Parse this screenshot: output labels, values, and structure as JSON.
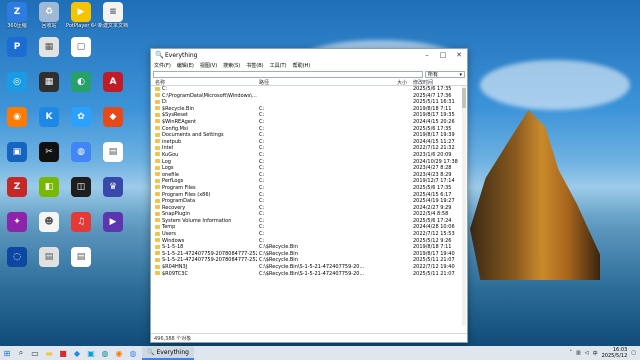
{
  "desktop": {
    "icons": [
      {
        "label": "360压缩",
        "color": "#2d7be0",
        "glyph": "Z",
        "col": 0,
        "row": 0
      },
      {
        "label": "回收站",
        "color": "#9fb8d6",
        "glyph": "♻",
        "col": 1,
        "row": 0
      },
      {
        "label": "PotPlayer 64 bit",
        "color": "#f5c400",
        "glyph": "▶",
        "col": 2,
        "row": 0
      },
      {
        "label": "新建文本文档 (2).txt",
        "color": "#f3f3f3",
        "glyph": "≡",
        "col": 3,
        "row": 0
      },
      {
        "label": "",
        "color": "#1b6dd1",
        "glyph": "P",
        "col": 0,
        "row": 1
      },
      {
        "label": "",
        "color": "#e2e2e2",
        "glyph": "▦",
        "col": 1,
        "row": 1
      },
      {
        "label": "",
        "color": "#ffffff",
        "glyph": "▢",
        "col": 2,
        "row": 1
      },
      {
        "label": "",
        "color": "#1a9be6",
        "glyph": "◎",
        "col": 0,
        "row": 2
      },
      {
        "label": "",
        "color": "#2f2f2f",
        "glyph": "▦",
        "col": 1,
        "row": 2
      },
      {
        "label": "",
        "color": "#26a269",
        "glyph": "◐",
        "col": 2,
        "row": 2
      },
      {
        "label": "",
        "color": "#c01c28",
        "glyph": "A",
        "col": 3,
        "row": 2
      },
      {
        "label": "",
        "color": "#ff7a00",
        "glyph": "◉",
        "col": 0,
        "row": 3
      },
      {
        "label": "",
        "color": "#1e88e5",
        "glyph": "K",
        "col": 1,
        "row": 3
      },
      {
        "label": "",
        "color": "#2aa0ff",
        "glyph": "✿",
        "col": 2,
        "row": 3
      },
      {
        "label": "",
        "color": "#e64a19",
        "glyph": "◆",
        "col": 3,
        "row": 3
      },
      {
        "label": "",
        "color": "#1565c0",
        "glyph": "▣",
        "col": 0,
        "row": 4
      },
      {
        "label": "",
        "color": "#111111",
        "glyph": "✂",
        "col": 1,
        "row": 4
      },
      {
        "label": "",
        "color": "#4285f4",
        "glyph": "◍",
        "col": 2,
        "row": 4
      },
      {
        "label": "",
        "color": "#ffffff",
        "glyph": "▤",
        "col": 3,
        "row": 4
      },
      {
        "label": "",
        "color": "#c62828",
        "glyph": "Z",
        "col": 0,
        "row": 5
      },
      {
        "label": "",
        "color": "#76b900",
        "glyph": "◧",
        "col": 1,
        "row": 5
      },
      {
        "label": "",
        "color": "#1e1e1e",
        "glyph": "◫",
        "col": 2,
        "row": 5
      },
      {
        "label": "",
        "color": "#3949ab",
        "glyph": "♛",
        "col": 3,
        "row": 5
      },
      {
        "label": "",
        "color": "#8e24aa",
        "glyph": "✦",
        "col": 0,
        "row": 6
      },
      {
        "label": "",
        "color": "#f5f5f5",
        "glyph": "☻",
        "col": 1,
        "row": 6
      },
      {
        "label": "",
        "color": "#e53935",
        "glyph": "♫",
        "col": 2,
        "row": 6
      },
      {
        "label": "",
        "color": "#5e35b1",
        "glyph": "▶",
        "col": 3,
        "row": 6
      },
      {
        "label": "",
        "color": "#0d47a1",
        "glyph": "◌",
        "col": 0,
        "row": 7
      },
      {
        "label": "",
        "color": "#e0e0e0",
        "glyph": "▤",
        "col": 1,
        "row": 7
      },
      {
        "label": "",
        "color": "#ffffff",
        "glyph": "▤",
        "col": 2,
        "row": 7
      }
    ]
  },
  "window": {
    "title": "Everything",
    "menu": [
      "文件(F)",
      "编辑(E)",
      "视图(V)",
      "搜索(S)",
      "书签(B)",
      "工具(T)",
      "帮助(H)"
    ],
    "search_value": "",
    "filter": "所有",
    "columns": {
      "name": "名称",
      "path": "路径",
      "size": "大小",
      "date": "修改时间"
    },
    "rows": [
      {
        "name": "C:",
        "path": "",
        "date": "2025/5/6 17:35"
      },
      {
        "name": "C:\\ProgramData\\Microsoft\\Windows\\...",
        "path": "",
        "date": "2025/4/7 17:36"
      },
      {
        "name": "D:",
        "path": "",
        "date": "2025/5/11 16:31"
      },
      {
        "name": "$Recycle.Bin",
        "path": "C:",
        "date": "2019/8/18 7:11"
      },
      {
        "name": "$SysReset",
        "path": "C:",
        "date": "2019/8/17 19:35"
      },
      {
        "name": "$WinREAgent",
        "path": "C:",
        "date": "2024/4/15 20:26"
      },
      {
        "name": "Config.Msi",
        "path": "C:",
        "date": "2025/5/6 17:35"
      },
      {
        "name": "Documents and Settings",
        "path": "C:",
        "date": "2019/8/17 19:39"
      },
      {
        "name": "inetpub",
        "path": "C:",
        "date": "2024/4/15 11:27"
      },
      {
        "name": "Intel",
        "path": "C:",
        "date": "2022/7/12 21:32"
      },
      {
        "name": "KuGou",
        "path": "C:",
        "date": "2023/1/6 20:09"
      },
      {
        "name": "Log",
        "path": "C:",
        "date": "2024/10/29 17:38"
      },
      {
        "name": "Logs",
        "path": "C:",
        "date": "2023/4/27 8:28"
      },
      {
        "name": "onefile",
        "path": "C:",
        "date": "2023/4/23 8:29"
      },
      {
        "name": "PerfLogs",
        "path": "C:",
        "date": "2019/12/7 17:14"
      },
      {
        "name": "Program Files",
        "path": "C:",
        "date": "2025/5/6 17:35"
      },
      {
        "name": "Program Files (x86)",
        "path": "C:",
        "date": "2025/4/15 6:17"
      },
      {
        "name": "ProgramData",
        "path": "C:",
        "date": "2025/4/19 19:27"
      },
      {
        "name": "Recovery",
        "path": "C:",
        "date": "2024/2/27 9:29"
      },
      {
        "name": "SnapPlugin",
        "path": "C:",
        "date": "2022/5/4 8:58"
      },
      {
        "name": "System Volume Information",
        "path": "C:",
        "date": "2025/5/6 17:24"
      },
      {
        "name": "Temp",
        "path": "C:",
        "date": "2024/4/28 10:06"
      },
      {
        "name": "Users",
        "path": "C:",
        "date": "2022/7/12 15:53"
      },
      {
        "name": "Windows",
        "path": "C:",
        "date": "2025/5/12 9:26"
      },
      {
        "name": "S-1-5-18",
        "path": "C:\\$Recycle.Bin",
        "date": "2019/8/18 7:11"
      },
      {
        "name": "S-1-5-21-472407759-2078084777-252...",
        "path": "C:\\$Recycle.Bin",
        "date": "2019/8/17 19:40"
      },
      {
        "name": "S-1-5-21-472407759-2078084777-252...",
        "path": "C:\\$Recycle.Bin",
        "date": "2025/5/11 21:07"
      },
      {
        "name": "$R04HN3J",
        "path": "C:\\$Recycle.Bin\\S-1-5-21-472407759-20...",
        "date": "2022/7/12 19:40"
      },
      {
        "name": "$R09TC3C",
        "path": "C:\\$Recycle.Bin\\S-1-5-21-472407759-20...",
        "date": "2025/5/11 21:07"
      }
    ],
    "status": "496,388 个对象"
  },
  "taskbar": {
    "app_label": "Everything",
    "time": "16:03",
    "date": "2025/5/12",
    "ime": "中",
    "accent": "#3b82f6"
  }
}
